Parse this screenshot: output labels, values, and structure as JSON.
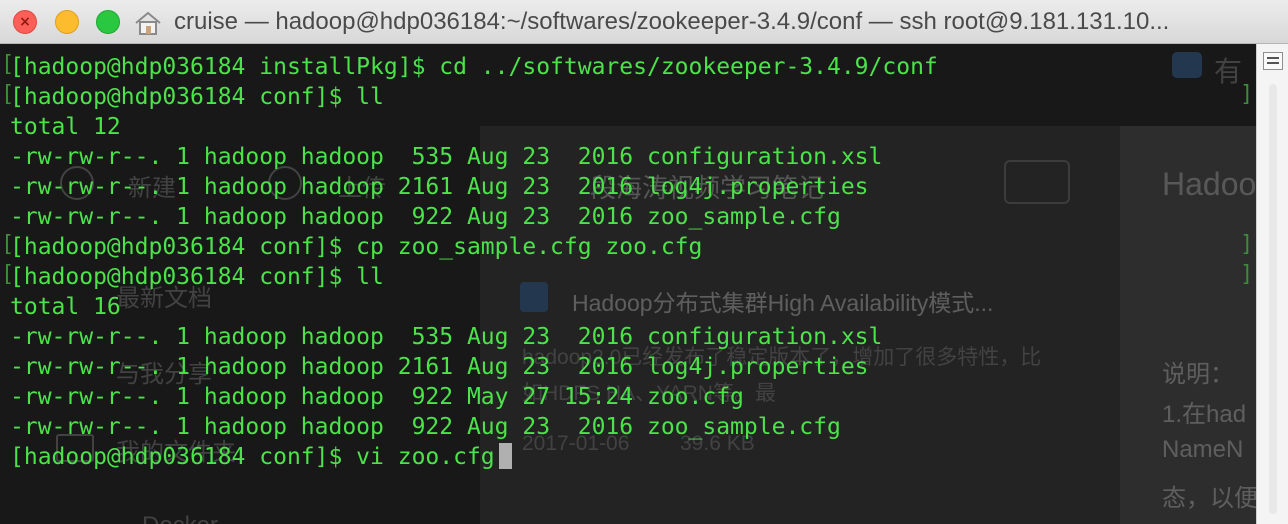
{
  "window": {
    "title": "cruise — hadoop@hdp036184:~/softwares/zookeeper-3.4.9/conf — ssh root@9.181.131.10...",
    "close_glyph": "×"
  },
  "terminal": {
    "text_color": "#4be349",
    "lines": [
      "[hadoop@hdp036184 installPkg]$ cd ../softwares/zookeeper-3.4.9/conf",
      "[hadoop@hdp036184 conf]$ ll",
      "total 12",
      "-rw-rw-r--. 1 hadoop hadoop  535 Aug 23  2016 configuration.xsl",
      "-rw-rw-r--. 1 hadoop hadoop 2161 Aug 23  2016 log4j.properties",
      "-rw-rw-r--. 1 hadoop hadoop  922 Aug 23  2016 zoo_sample.cfg",
      "[hadoop@hdp036184 conf]$ cp zoo_sample.cfg zoo.cfg",
      "[hadoop@hdp036184 conf]$ ll",
      "total 16",
      "-rw-rw-r--. 1 hadoop hadoop  535 Aug 23  2016 configuration.xsl",
      "-rw-rw-r--. 1 hadoop hadoop 2161 Aug 23  2016 log4j.properties",
      "-rw-rw-r--. 1 hadoop hadoop  922 May 27 15:24 zoo.cfg",
      "-rw-rw-r--. 1 hadoop hadoop  922 Aug 23  2016 zoo_sample.cfg",
      "[hadoop@hdp036184 conf]$ vi zoo.cfg"
    ],
    "bracket_left": "[",
    "bracket_right": "]"
  },
  "background_app": {
    "top_right_char": "有",
    "new_label": "新建",
    "upload_label": "上传",
    "recent_docs": "最新文档",
    "shared_with_me": "与我分享",
    "my_folders": "我的文件夹",
    "docker": "Docker",
    "notebook_title": "段海涛视频学习笔记",
    "doc_title": "Hadoop分布式集群High Availability模式...",
    "doc_snippet": "hadoop2.0已经发布了稳定版本了，增加了很多特性，比如HDFS HA、YARN等。最",
    "doc_date": "2017-01-06",
    "doc_size": "39.6 KB",
    "right_title": "Hadoo",
    "right_note_1": "说明：",
    "right_note_2": "1.在had",
    "right_note_3": "NameN",
    "right_note_4": "态，以便"
  }
}
